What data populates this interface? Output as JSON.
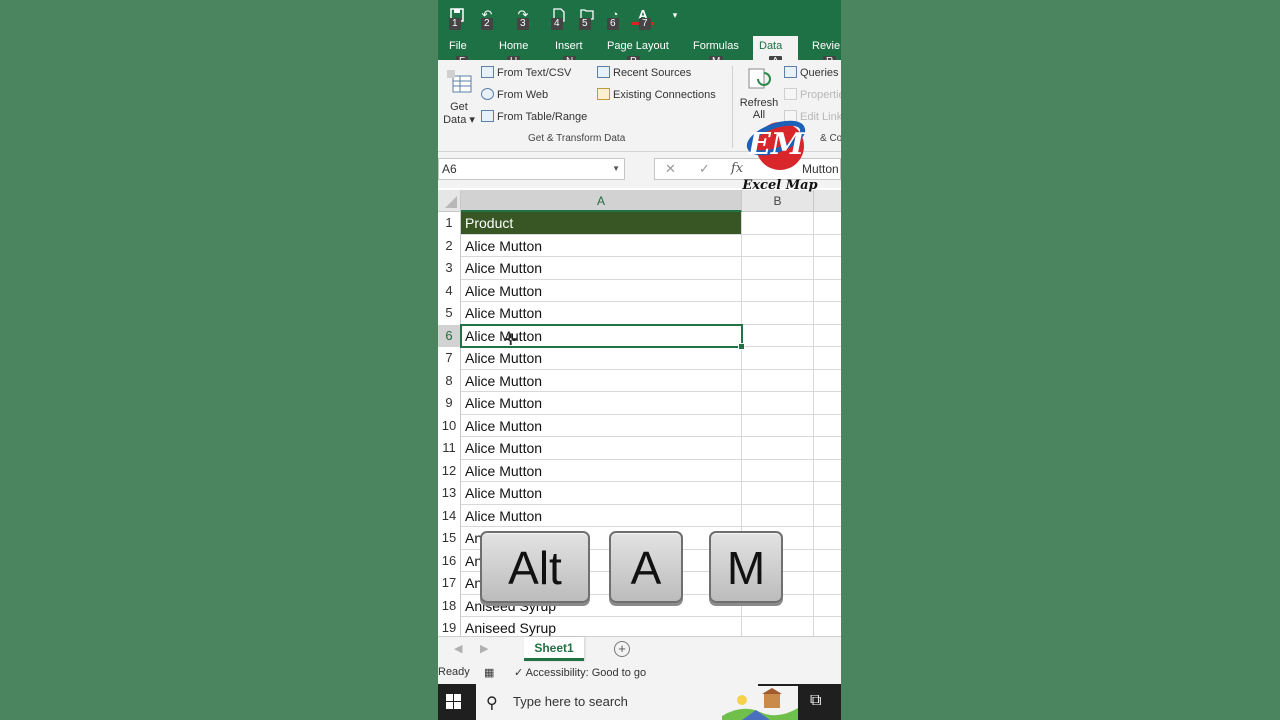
{
  "quick_access": {
    "keytips": [
      "1",
      "2",
      "3",
      "4",
      "5",
      "6",
      "7"
    ],
    "icons": [
      "save-icon",
      "undo-icon",
      "redo-icon",
      "new-file-icon",
      "open-file-icon",
      "touch-mode-icon",
      "font-color-icon",
      "customize-icon"
    ]
  },
  "tabs": [
    {
      "label": "File",
      "keytip": "F"
    },
    {
      "label": "Home",
      "keytip": "H"
    },
    {
      "label": "Insert",
      "keytip": "N"
    },
    {
      "label": "Page Layout",
      "keytip": "P"
    },
    {
      "label": "Formulas",
      "keytip": "M"
    },
    {
      "label": "Data",
      "keytip": "A",
      "active": true
    },
    {
      "label": "Revie",
      "keytip": "R"
    }
  ],
  "ribbon": {
    "get_data_line1": "Get",
    "get_data_line2": "Data",
    "from_text_csv": "From Text/CSV",
    "from_web": "From Web",
    "from_table_range": "From Table/Range",
    "recent_sources": "Recent Sources",
    "existing_connections": "Existing Connections",
    "group_label": "Get & Transform Data",
    "refresh_line1": "Refresh",
    "refresh_line2": "All",
    "queries": "Queries",
    "properties": "Propertie",
    "edit_links": "Edit Link",
    "group2_label": "& Co"
  },
  "formula_bar": {
    "name_box": "A6",
    "cancel": "✕",
    "enter": "✓",
    "fx": "fx",
    "value": "Mutton"
  },
  "logo": {
    "mark": "EM",
    "text": "Excel Map"
  },
  "grid": {
    "columns": [
      "A",
      "B"
    ],
    "selected_cell": "A6",
    "rows": [
      {
        "num": "1",
        "a": "Product"
      },
      {
        "num": "2",
        "a": "Alice Mutton"
      },
      {
        "num": "3",
        "a": "Alice Mutton"
      },
      {
        "num": "4",
        "a": "Alice Mutton"
      },
      {
        "num": "5",
        "a": "Alice Mutton"
      },
      {
        "num": "6",
        "a": "Alice Mutton"
      },
      {
        "num": "7",
        "a": "Alice Mutton"
      },
      {
        "num": "8",
        "a": "Alice Mutton"
      },
      {
        "num": "9",
        "a": "Alice Mutton"
      },
      {
        "num": "10",
        "a": "Alice Mutton"
      },
      {
        "num": "11",
        "a": "Alice Mutton"
      },
      {
        "num": "12",
        "a": "Alice Mutton"
      },
      {
        "num": "13",
        "a": "Alice Mutton"
      },
      {
        "num": "14",
        "a": "Alice Mutton"
      },
      {
        "num": "15",
        "a": "An"
      },
      {
        "num": "16",
        "a": "An"
      },
      {
        "num": "17",
        "a": "An"
      },
      {
        "num": "18",
        "a": "Aniseed Syrup"
      },
      {
        "num": "19",
        "a": "Aniseed Syrup"
      }
    ]
  },
  "keys": [
    "Alt",
    "A",
    "M"
  ],
  "sheets": {
    "active": "Sheet1",
    "add": "+"
  },
  "status": {
    "ready": "Ready",
    "accessibility": "Accessibility: Good to go"
  },
  "taskbar": {
    "search_placeholder": "Type here to search"
  },
  "colors": {
    "excel_green": "#1e7145",
    "header_fill": "#375623",
    "selection": "#217346",
    "background": "#4a8560"
  }
}
